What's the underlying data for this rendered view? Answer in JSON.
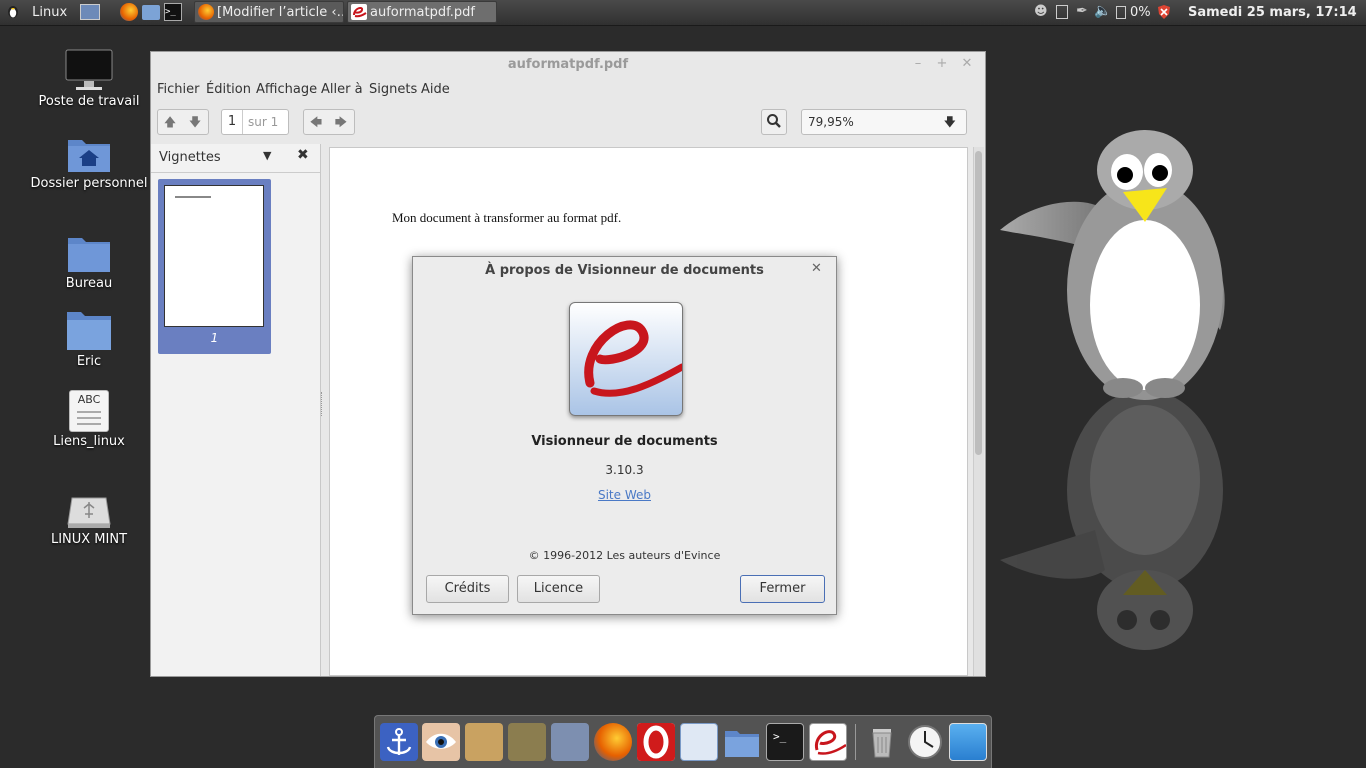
{
  "top_panel": {
    "menu_label": "Linux",
    "tasks": [
      {
        "label": "[Modifier l’article ‹…",
        "icon": "firefox-icon"
      },
      {
        "label": "auformatpdf.pdf",
        "icon": "evince-icon"
      }
    ],
    "battery": "0%",
    "clock": "Samedi 25 mars, 17:14"
  },
  "desktop_icons": [
    {
      "label": "Poste de travail",
      "icon": "computer-icon"
    },
    {
      "label": "Dossier personnel",
      "icon": "home-folder-icon"
    },
    {
      "label": "Bureau",
      "icon": "folder-icon"
    },
    {
      "label": "Eric",
      "icon": "folder-icon"
    },
    {
      "label": "Liens_linux",
      "icon": "text-file-icon",
      "icon_text": "ABC"
    },
    {
      "label": "LINUX MINT",
      "icon": "usb-drive-icon"
    }
  ],
  "window": {
    "title": "auformatpdf.pdf",
    "menus": [
      "Fichier",
      "Édition",
      "Affichage",
      "Aller à",
      "Signets",
      "Aide"
    ],
    "page_current": "1",
    "page_total_label": "sur 1",
    "zoom": "79,95%",
    "sidebar_title": "Vignettes",
    "thumbnail_page": "1",
    "document_text": "Mon document à transformer au format pdf."
  },
  "about_dialog": {
    "title": "À propos de Visionneur de documents",
    "app_name": "Visionneur de documents",
    "version": "3.10.3",
    "website_label": "Site Web",
    "copyright": "© 1996-2012 Les auteurs d'Evince",
    "buttons": {
      "credits": "Crédits",
      "license": "Licence",
      "close": "Fermer"
    }
  },
  "colors": {
    "accent": "#6a7fc1",
    "link": "#4a79c6",
    "evince_red": "#c8161d"
  }
}
